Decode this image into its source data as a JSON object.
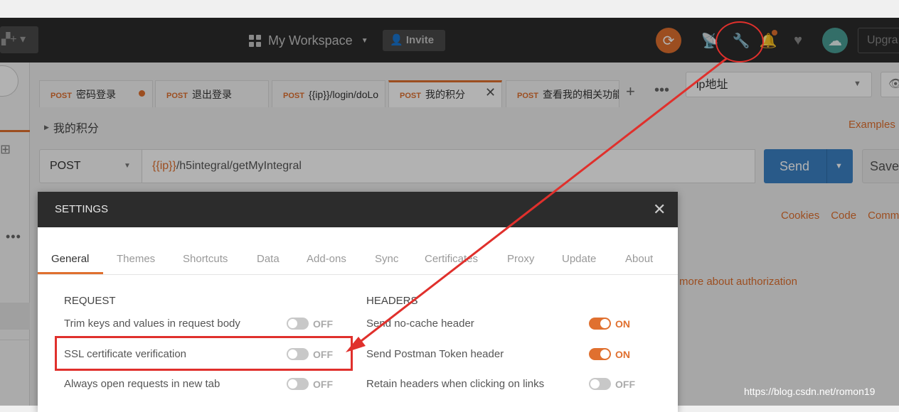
{
  "header": {
    "workspace_label": "My Workspace",
    "invite_label": "Invite",
    "upgrade_label": "Upgra",
    "icons": [
      "new-icon",
      "workspace-grid-icon",
      "sync-icon",
      "satellite-icon",
      "wrench-icon",
      "bell-icon",
      "heart-icon",
      "cloud-icon"
    ]
  },
  "tabs": [
    {
      "method": "POST",
      "label": "密码登录"
    },
    {
      "method": "POST",
      "label": "退出登录"
    },
    {
      "method": "POST",
      "label": "{{ip}}/login/doLo"
    },
    {
      "method": "POST",
      "label": "我的积分"
    },
    {
      "method": "POST",
      "label": "查看我的相关功能"
    }
  ],
  "env": {
    "selected": "ip地址"
  },
  "request": {
    "title": "我的积分",
    "examples_label": "Examples",
    "method": "POST",
    "url_var": "{{ip}}",
    "url_path": "/h5integral/getMyIntegral",
    "send_label": "Send",
    "save_label": "Save",
    "links": [
      "Cookies",
      "Code",
      "Comme"
    ],
    "auth_text": "more about authorization"
  },
  "settings": {
    "title": "SETTINGS",
    "tabs": [
      "General",
      "Themes",
      "Shortcuts",
      "Data",
      "Add-ons",
      "Sync",
      "Certificates",
      "Proxy",
      "Update",
      "About"
    ],
    "active_tab": "General",
    "request_heading": "REQUEST",
    "headers_heading": "HEADERS",
    "request_rows": [
      {
        "label": "Trim keys and values in request body",
        "state": "OFF"
      },
      {
        "label": "SSL certificate verification",
        "state": "OFF"
      },
      {
        "label": "Always open requests in new tab",
        "state": "OFF"
      }
    ],
    "headers_rows": [
      {
        "label": "Send no-cache header",
        "state": "ON"
      },
      {
        "label": "Send Postman Token header",
        "state": "ON"
      },
      {
        "label": "Retain headers when clicking on links",
        "state": "OFF"
      }
    ]
  },
  "annotation": {
    "color": "#e0302c"
  },
  "colors": {
    "accent": "#e0702f",
    "send": "#3b82c4",
    "header_bg": "#2c2c2c"
  },
  "watermark": "https://blog.csdn.net/romon19"
}
